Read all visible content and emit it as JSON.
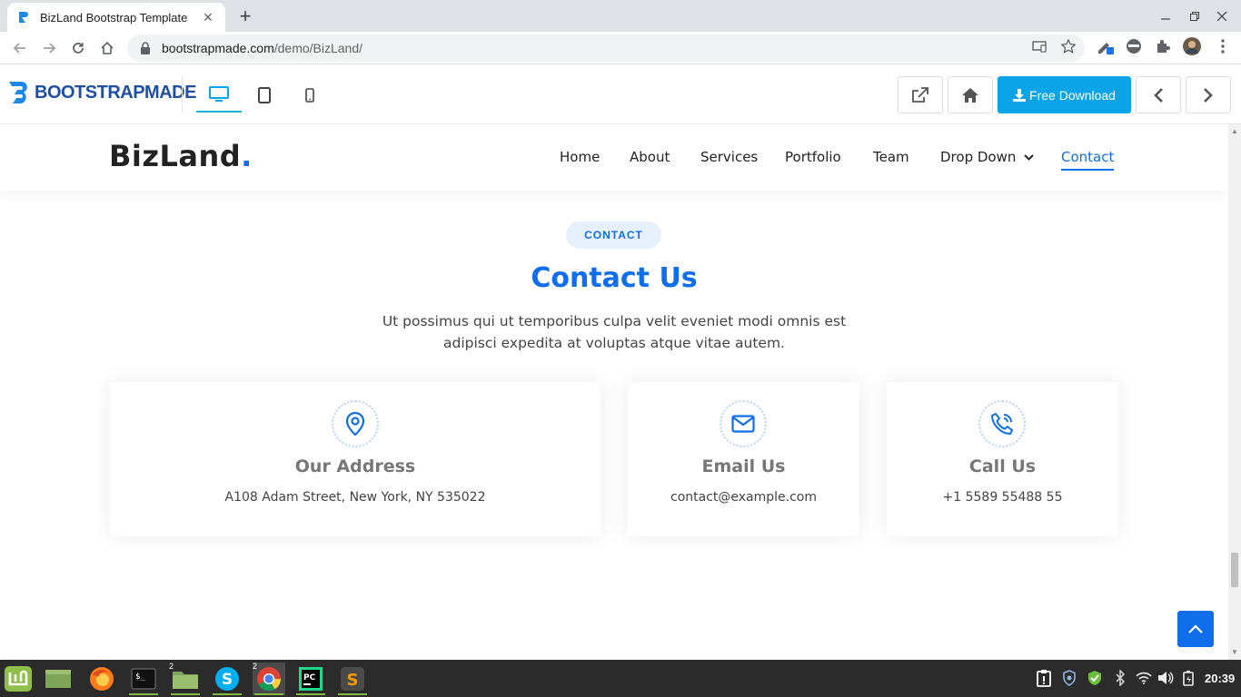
{
  "browser": {
    "tab_title": "BizLand Bootstrap Template",
    "url_host": "bootstrapmade.com",
    "url_path": "/demo/BizLand/"
  },
  "preview_bar": {
    "brand": "BOOTSTRAPMADE",
    "download_label": "Free Download"
  },
  "site": {
    "logo_text": "BizLand",
    "logo_dot": ".",
    "nav": [
      {
        "label": "Home"
      },
      {
        "label": "About"
      },
      {
        "label": "Services"
      },
      {
        "label": "Portfolio"
      },
      {
        "label": "Team"
      },
      {
        "label": "Drop Down"
      },
      {
        "label": "Contact",
        "active": true
      }
    ]
  },
  "contact": {
    "badge": "CONTACT",
    "title": "Contact Us",
    "description": "Ut possimus qui ut temporibus culpa velit eveniet modi omnis est adipisci expedita at voluptas atque vitae autem.",
    "boxes": [
      {
        "icon": "map-pin-icon",
        "title": "Our Address",
        "text": "A108 Adam Street, New York, NY 535022"
      },
      {
        "icon": "envelope-icon",
        "title": "Email Us",
        "text": "contact@example.com"
      },
      {
        "icon": "phone-icon",
        "title": "Call Us",
        "text": "+1 5589 55488 55"
      }
    ]
  },
  "taskbar": {
    "clock": "20:39",
    "badges": {
      "files": "2",
      "chrome": "2"
    }
  },
  "colors": {
    "accent": "#106eea",
    "download": "#0ba4e8",
    "taskbar": "#2b2b2b"
  }
}
